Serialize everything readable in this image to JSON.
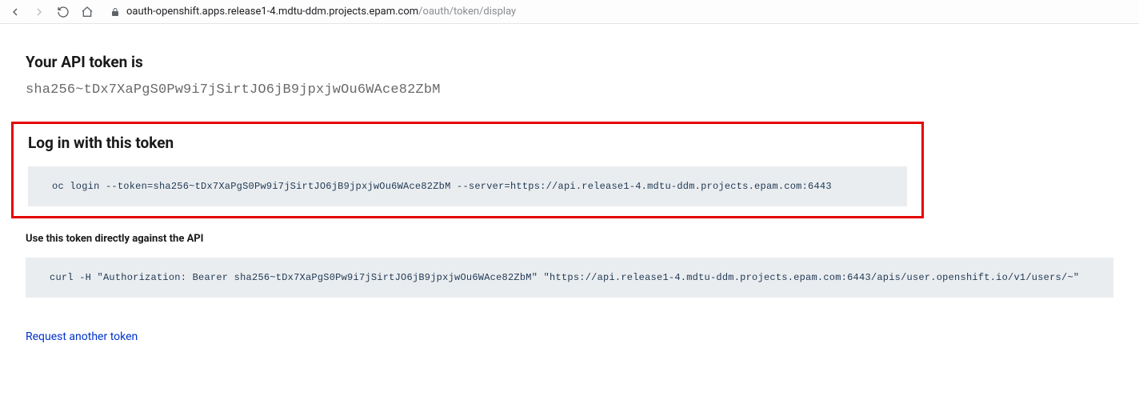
{
  "browser": {
    "url_domain": "oauth-openshift.apps.release1-4.mdtu-ddm.projects.epam.com",
    "url_path": "/oauth/token/display"
  },
  "page": {
    "heading": "Your API token is",
    "token": "sha256~tDx7XaPgS0Pw9i7jSirtJO6jB9jpxjwOu6WAce82ZbM",
    "login_heading": "Log in with this token",
    "login_command": "oc login --token=sha256~tDx7XaPgS0Pw9i7jSirtJO6jB9jpxjwOu6WAce82ZbM --server=https://api.release1-4.mdtu-ddm.projects.epam.com:6443",
    "api_heading": "Use this token directly against the API",
    "curl_command": "curl -H \"Authorization: Bearer sha256~tDx7XaPgS0Pw9i7jSirtJO6jB9jpxjwOu6WAce82ZbM\" \"https://api.release1-4.mdtu-ddm.projects.epam.com:6443/apis/user.openshift.io/v1/users/~\"",
    "request_link": "Request another token"
  }
}
